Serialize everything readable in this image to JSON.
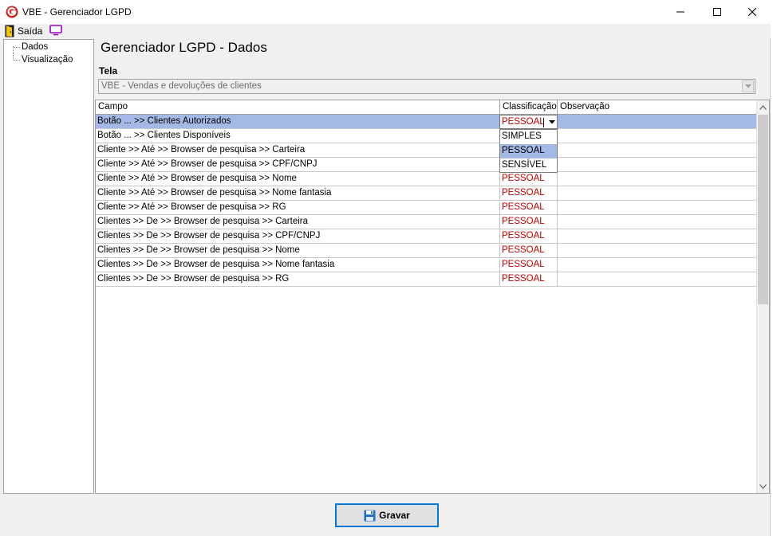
{
  "window": {
    "title": "VBE - Gerenciador LGPD",
    "icon": "g-logo-icon"
  },
  "menu": {
    "exit_label": "Saída",
    "exit_icon": "door-exit-icon",
    "monitor_icon": "monitor-icon"
  },
  "tree": {
    "items": [
      {
        "label": "Dados"
      },
      {
        "label": "Visualização"
      }
    ]
  },
  "main": {
    "title": "Gerenciador LGPD - Dados",
    "tela_label": "Tela",
    "tela_value": "VBE - Vendas e devoluções de clientes"
  },
  "grid": {
    "columns": [
      "Campo",
      "Classificação",
      "Observação"
    ],
    "rows": [
      {
        "campo": "Botão ... >> Clientes Autorizados",
        "classificacao": "PESSOAL",
        "observacao": ""
      },
      {
        "campo": "Botão ... >> Clientes Disponíveis",
        "classificacao": "",
        "observacao": ""
      },
      {
        "campo": "Cliente >> Até >> Browser de pesquisa >> Carteira",
        "classificacao": "",
        "observacao": ""
      },
      {
        "campo": "Cliente >> Até >> Browser de pesquisa >> CPF/CNPJ",
        "classificacao": "",
        "observacao": ""
      },
      {
        "campo": "Cliente >> Até >> Browser de pesquisa >> Nome",
        "classificacao": "PESSOAL",
        "observacao": ""
      },
      {
        "campo": "Cliente >> Até >> Browser de pesquisa >> Nome fantasia",
        "classificacao": "PESSOAL",
        "observacao": ""
      },
      {
        "campo": "Cliente >> Até >> Browser de pesquisa >> RG",
        "classificacao": "PESSOAL",
        "observacao": ""
      },
      {
        "campo": "Clientes >> De >> Browser de pesquisa >> Carteira",
        "classificacao": "PESSOAL",
        "observacao": ""
      },
      {
        "campo": "Clientes >> De >> Browser de pesquisa >> CPF/CNPJ",
        "classificacao": "PESSOAL",
        "observacao": ""
      },
      {
        "campo": "Clientes >> De >> Browser de pesquisa >> Nome",
        "classificacao": "PESSOAL",
        "observacao": ""
      },
      {
        "campo": "Clientes >> De >> Browser de pesquisa >> Nome fantasia",
        "classificacao": "PESSOAL",
        "observacao": ""
      },
      {
        "campo": "Clientes >> De >> Browser de pesquisa >> RG",
        "classificacao": "PESSOAL",
        "observacao": ""
      }
    ],
    "editor_value": "PESSOAL",
    "dropdown_options": [
      "SIMPLES",
      "PESSOAL",
      "SENSÍVEL"
    ],
    "dropdown_selected": "PESSOAL"
  },
  "footer": {
    "save_label": "Gravar",
    "save_icon": "floppy-disk-icon"
  },
  "colors": {
    "selection": "#a4b9e6",
    "classification_text": "#c00000",
    "button_focus_border": "#0078d7"
  }
}
